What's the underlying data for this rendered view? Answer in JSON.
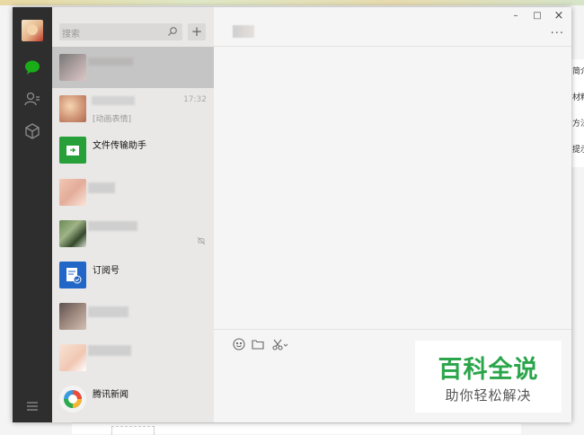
{
  "background": {
    "right_panel_items": [
      "简介",
      "材料",
      "方法",
      "提示"
    ]
  },
  "window_controls": {
    "minimize": "–",
    "maximize": "□",
    "close": "×"
  },
  "sidebar": {
    "icons": [
      "avatar",
      "chat-icon",
      "contacts-icon",
      "favorites-icon",
      "menu-icon"
    ]
  },
  "search": {
    "placeholder": "搜索",
    "add_label": "+"
  },
  "conversations": [
    {
      "name": "",
      "time": "",
      "sub": ""
    },
    {
      "name": "",
      "time": "17:32",
      "sub": "[动画表情]"
    },
    {
      "name": "文件传输助手",
      "time": "",
      "sub": ""
    },
    {
      "name": "",
      "time": "",
      "sub": ""
    },
    {
      "name": "",
      "time": "",
      "sub": ""
    },
    {
      "name": "订阅号",
      "time": "",
      "sub": ""
    },
    {
      "name": "",
      "time": "",
      "sub": ""
    },
    {
      "name": "",
      "time": "",
      "sub": ""
    },
    {
      "name": "腾讯新闻",
      "time": "",
      "sub": ""
    }
  ],
  "chat": {
    "more_label": "···"
  },
  "watermark": {
    "title": "百科全说",
    "subtitle": "助你轻松解决"
  },
  "colors": {
    "accent": "#1aad19",
    "rail": "#2e2e2e",
    "list": "#eae8e7",
    "active": "#c6c5c5",
    "watermark": "#2aa54a"
  }
}
